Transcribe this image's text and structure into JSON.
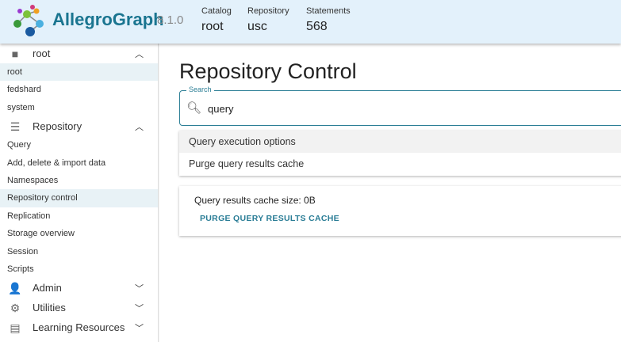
{
  "header": {
    "brand": "AllegroGraph",
    "version": "8.1.0",
    "catalog": {
      "label": "Catalog",
      "value": "root"
    },
    "repository": {
      "label": "Repository",
      "value": "usc"
    },
    "statements": {
      "label": "Statements",
      "value": "568"
    }
  },
  "sidebar": {
    "catalog_group": {
      "label": "root",
      "icon": "folder-icon",
      "items": [
        "root",
        "fedshard",
        "system"
      ]
    },
    "repository_group": {
      "label": "Repository",
      "icon": "list-icon",
      "items": [
        "Query",
        "Add, delete & import data",
        "Namespaces",
        "Repository control",
        "Replication",
        "Storage overview",
        "Session",
        "Scripts"
      ]
    },
    "admin": {
      "label": "Admin",
      "icon": "user-gear-icon"
    },
    "utilities": {
      "label": "Utilities",
      "icon": "gear-icon"
    },
    "learning": {
      "label": "Learning Resources",
      "icon": "book-icon"
    }
  },
  "main": {
    "title": "Repository Control",
    "search": {
      "label": "Search",
      "value": "query"
    },
    "options": [
      "Query execution options",
      "Purge query results cache"
    ],
    "card": {
      "text": "Query results cache size: 0B",
      "button": "PURGE QUERY RESULTS CACHE"
    }
  }
}
